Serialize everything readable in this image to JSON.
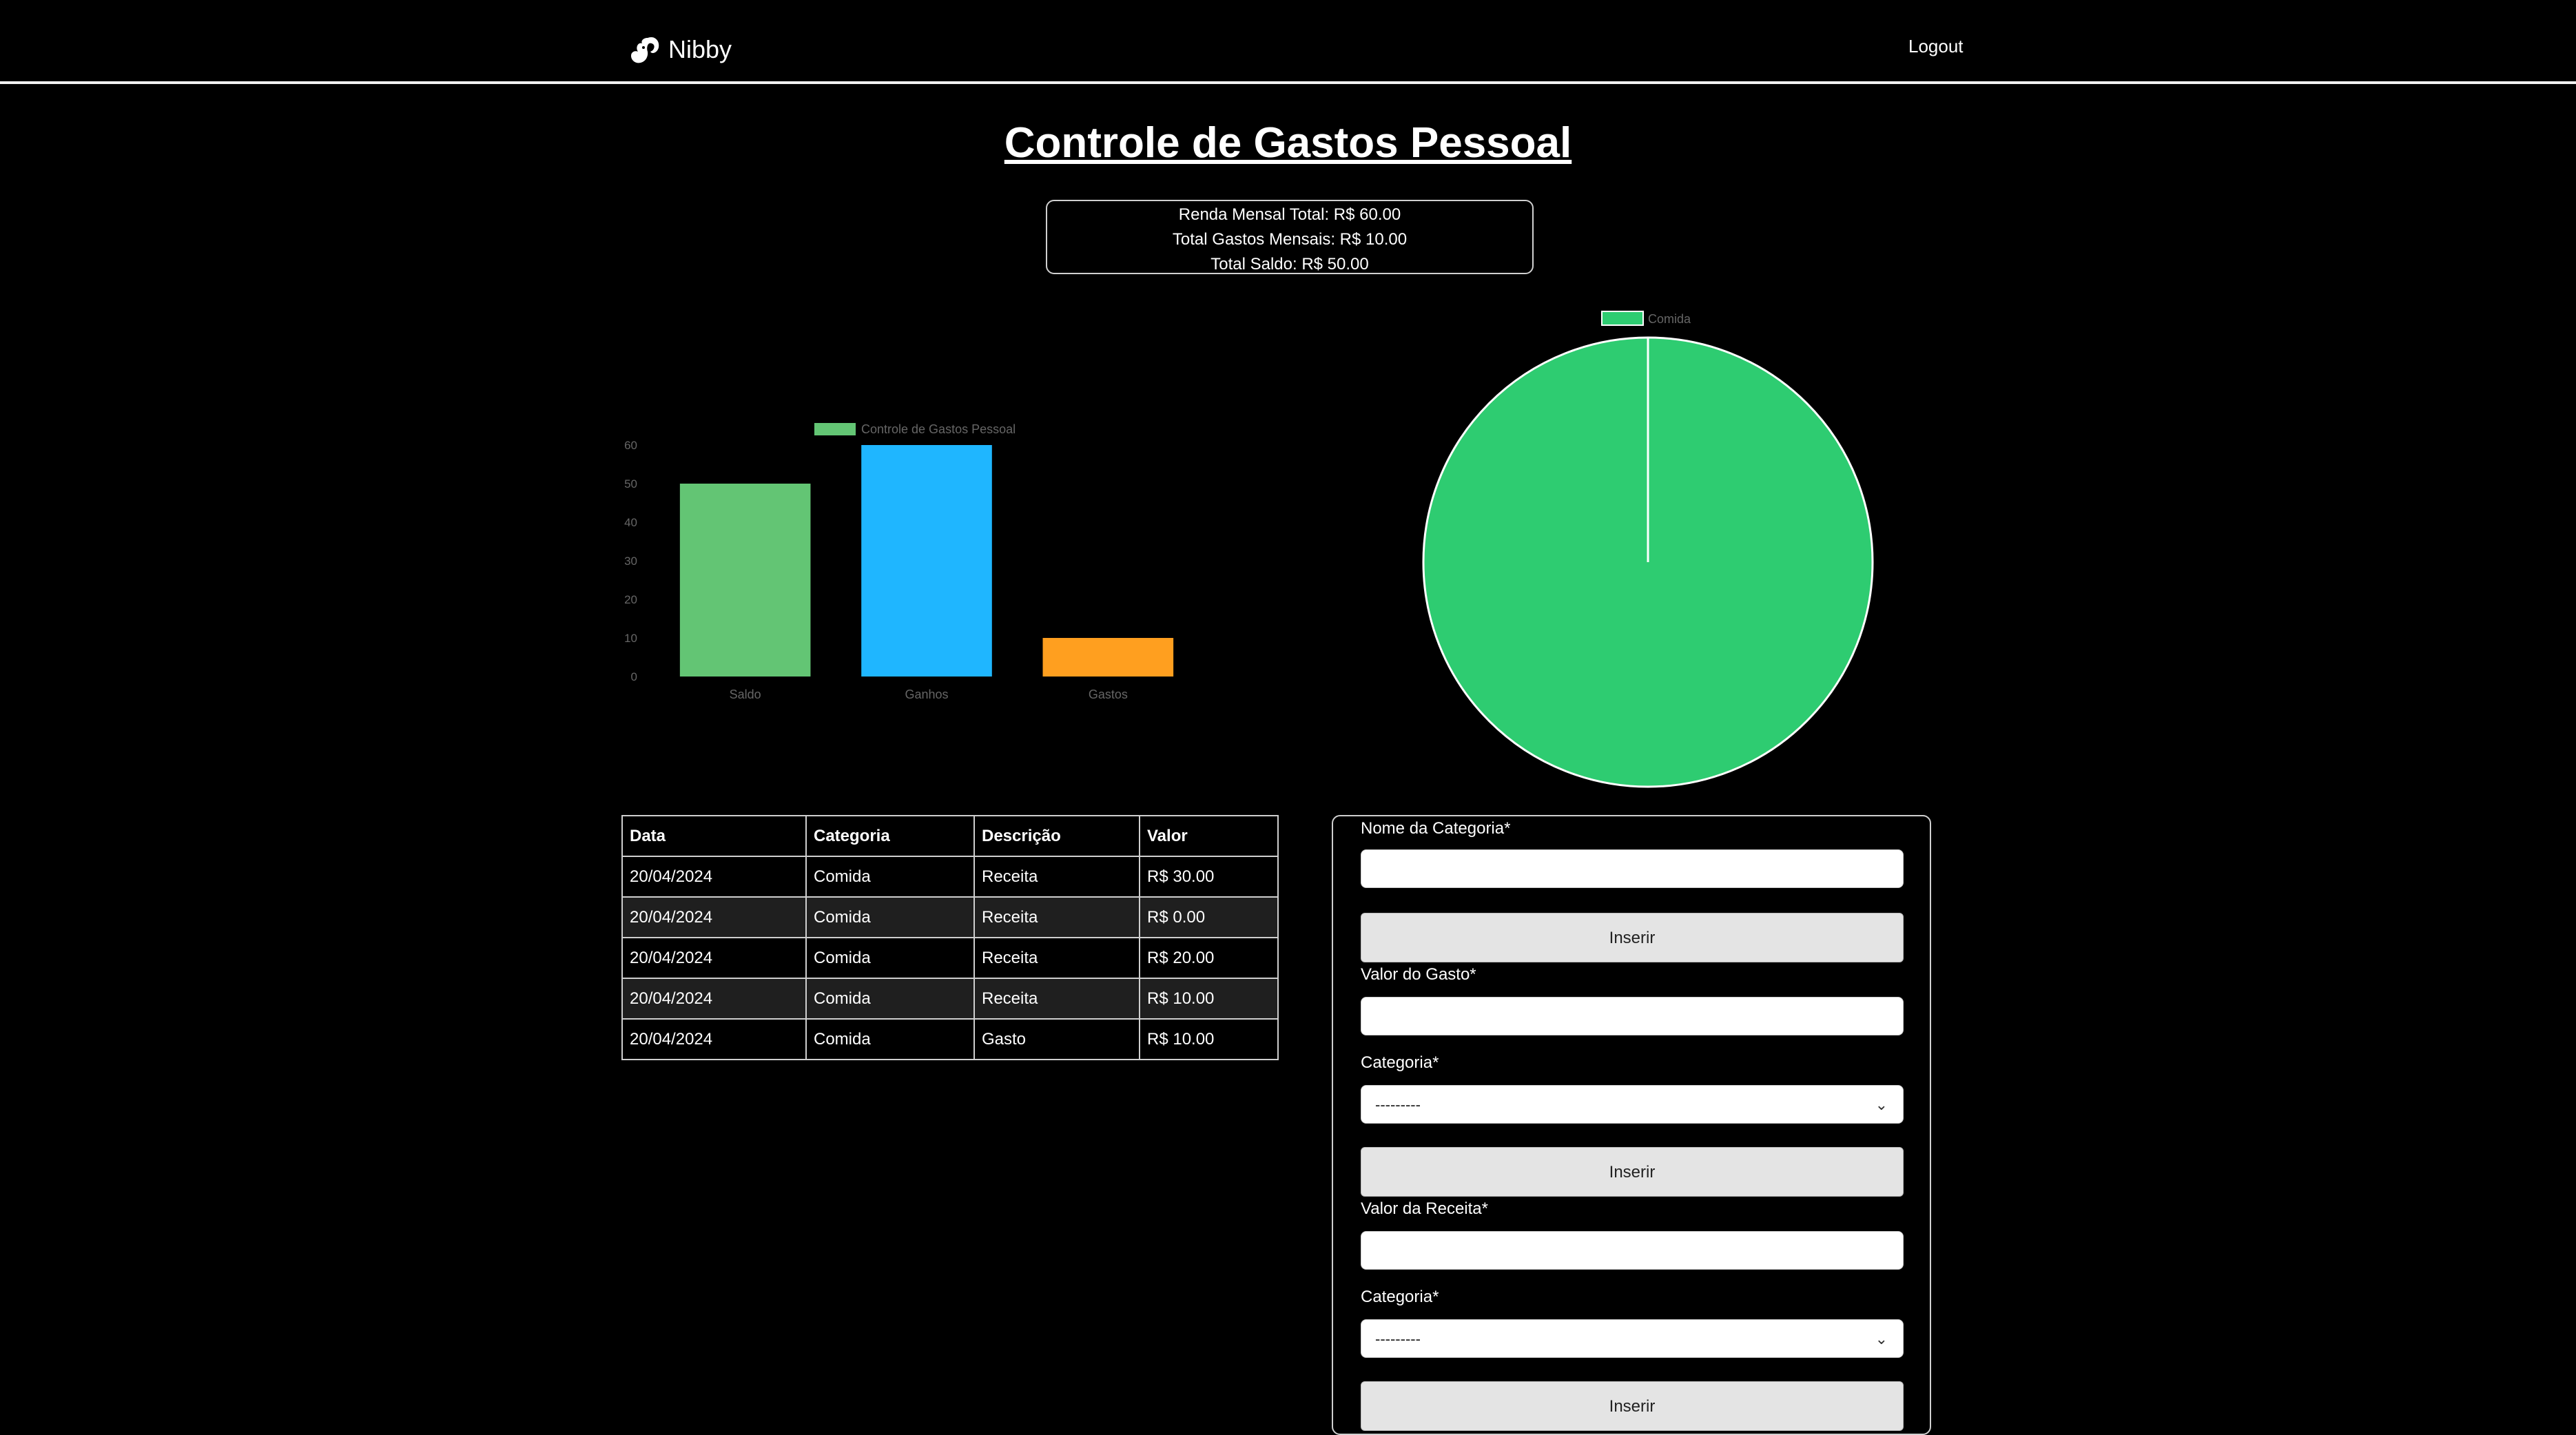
{
  "nav": {
    "brand": "Nibby",
    "logout": "Logout"
  },
  "page": {
    "title": "Controle de Gastos Pessoal"
  },
  "summary": {
    "renda": "Renda Mensal Total: R$ 60.00",
    "gastos": "Total Gastos Mensais: R$ 10.00",
    "saldo": "Total Saldo: R$ 50.00"
  },
  "chart_data": [
    {
      "type": "bar",
      "title": "",
      "legend": "Controle de Gastos Pessoal",
      "legend_position": "top",
      "categories": [
        "Saldo",
        "Ganhos",
        "Gastos"
      ],
      "values": [
        50,
        60,
        10
      ],
      "colors": [
        "#63c574",
        "#1fb6ff",
        "#ff9f1f"
      ],
      "ylim": [
        0,
        60
      ],
      "yticks": [
        0,
        10,
        20,
        30,
        40,
        50,
        60
      ],
      "grid": false
    },
    {
      "type": "pie",
      "title": "",
      "legend": "Comida",
      "legend_position": "top",
      "labels": [
        "Comida",
        ""
      ],
      "values": [
        10,
        0
      ],
      "colors": [
        "#2ecc71",
        "#2ecc71"
      ]
    }
  ],
  "table": {
    "headers": [
      "Data",
      "Categoria",
      "Descrição",
      "Valor"
    ],
    "rows": [
      [
        "20/04/2024",
        "Comida",
        "Receita",
        "R$ 30.00"
      ],
      [
        "20/04/2024",
        "Comida",
        "Receita",
        "R$ 0.00"
      ],
      [
        "20/04/2024",
        "Comida",
        "Receita",
        "R$ 20.00"
      ],
      [
        "20/04/2024",
        "Comida",
        "Receita",
        "R$ 10.00"
      ],
      [
        "20/04/2024",
        "Comida",
        "Gasto",
        "R$ 10.00"
      ]
    ]
  },
  "form": {
    "categoria_nome_label": "Nome da Categoria*",
    "inserir_1": "Inserir",
    "valor_gasto_label": "Valor do Gasto*",
    "categoria_label_1": "Categoria*",
    "select_1_value": "---------",
    "inserir_2": "Inserir",
    "valor_receita_label": "Valor da Receita*",
    "categoria_label_2": "Categoria*",
    "select_2_value": "---------",
    "inserir_3": "Inserir"
  },
  "colors": {
    "background": "#000000",
    "bar_saldo": "#63c574",
    "bar_ganhos": "#1fb6ff",
    "bar_gastos": "#ff9f1f",
    "pie": "#2ecc71"
  },
  "icons": {
    "brand": "squirrel-logo-icon",
    "select_chevron": "chevron-down-icon"
  }
}
